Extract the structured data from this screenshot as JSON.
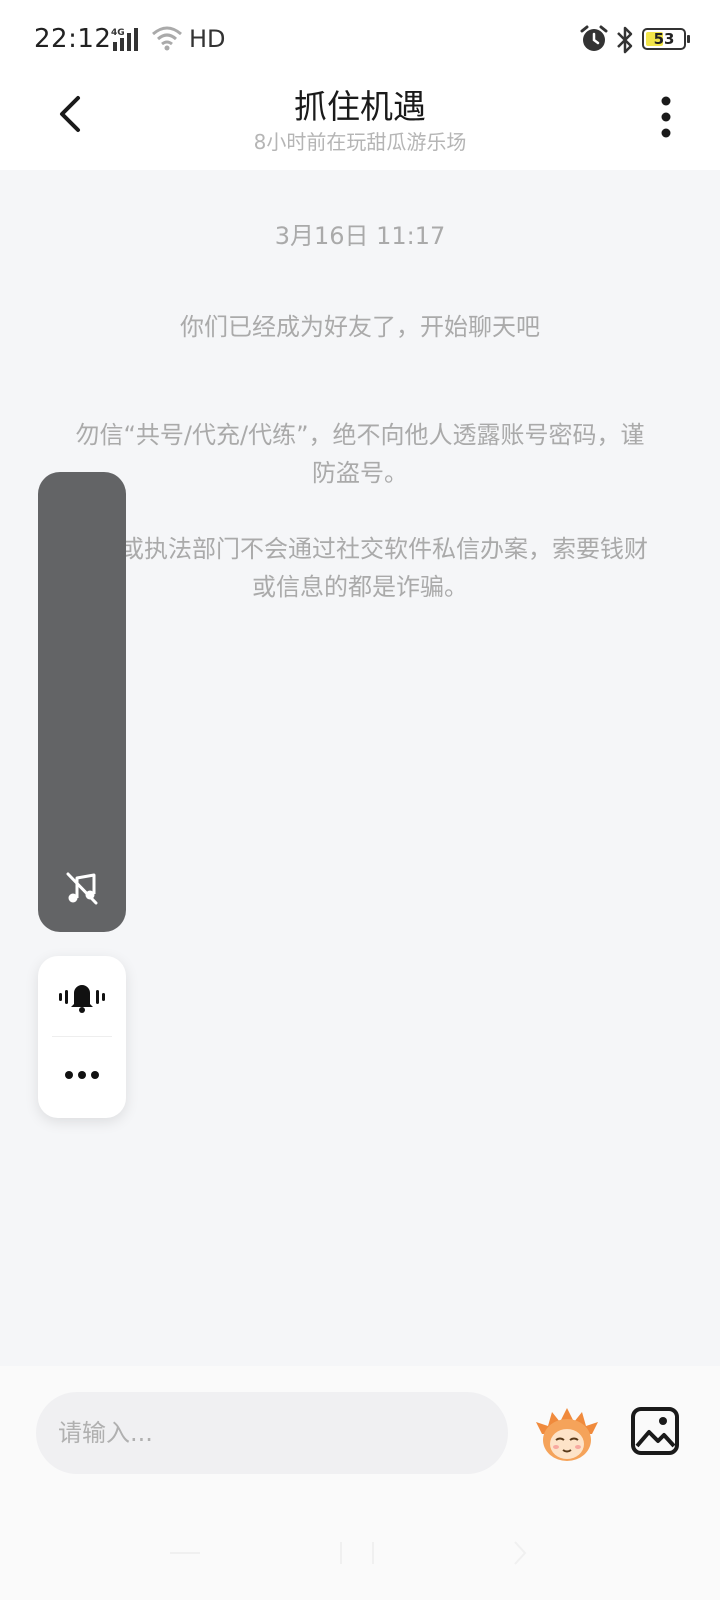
{
  "status_bar": {
    "time": "22:12",
    "network_label": "4G",
    "hd_label": "HD",
    "battery_level": "53",
    "battery_fraction": 0.53
  },
  "header": {
    "title": "抓住机遇",
    "subtitle": "8小时前在玩甜瓜游乐场"
  },
  "chat": {
    "timestamp": "3月16日 11:17",
    "messages": [
      "你们已经成为好友了，开始聊天吧",
      "勿信“共号/代充/代练”，绝不向他人透露账号密码，谨防盗号。",
      "官方或执法部门不会通过社交软件私信办案，索要钱财或信息的都是诈骗。"
    ]
  },
  "input": {
    "placeholder": "请输入..."
  },
  "icons": {
    "back": "chevron-left-icon",
    "more": "more-vertical-icon",
    "music_off": "music-off-icon",
    "bell": "bell-ring-icon",
    "dots": "more-horizontal-icon",
    "emoji": "emoji-character-icon",
    "image": "image-icon"
  },
  "colors": {
    "chat_background": "#f5f6f8",
    "music_panel": "#636466",
    "battery_fill": "#f2e54a",
    "system_text": "#aaaaaa"
  }
}
